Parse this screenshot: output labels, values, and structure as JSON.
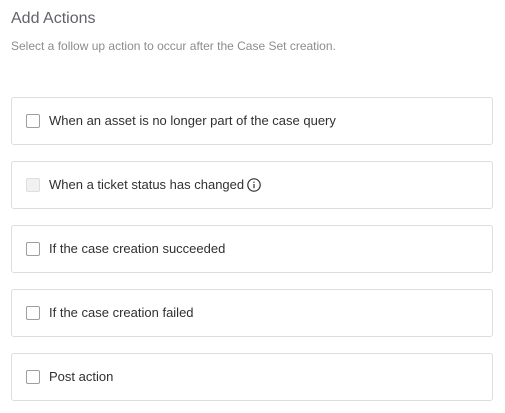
{
  "header": {
    "title": "Add Actions",
    "subtitle": "Select a follow up action to occur after the Case Set creation."
  },
  "options": [
    {
      "label": "When an asset is no longer part of the case query",
      "checked": false,
      "disabled": false
    },
    {
      "label": "When a ticket status has changed",
      "checked": false,
      "disabled": true,
      "icon": "info-icon"
    },
    {
      "label": "If the case creation succeeded",
      "checked": false,
      "disabled": false
    },
    {
      "label": "If the case creation failed",
      "checked": false,
      "disabled": false
    },
    {
      "label": "Post action",
      "checked": false,
      "disabled": false
    }
  ]
}
